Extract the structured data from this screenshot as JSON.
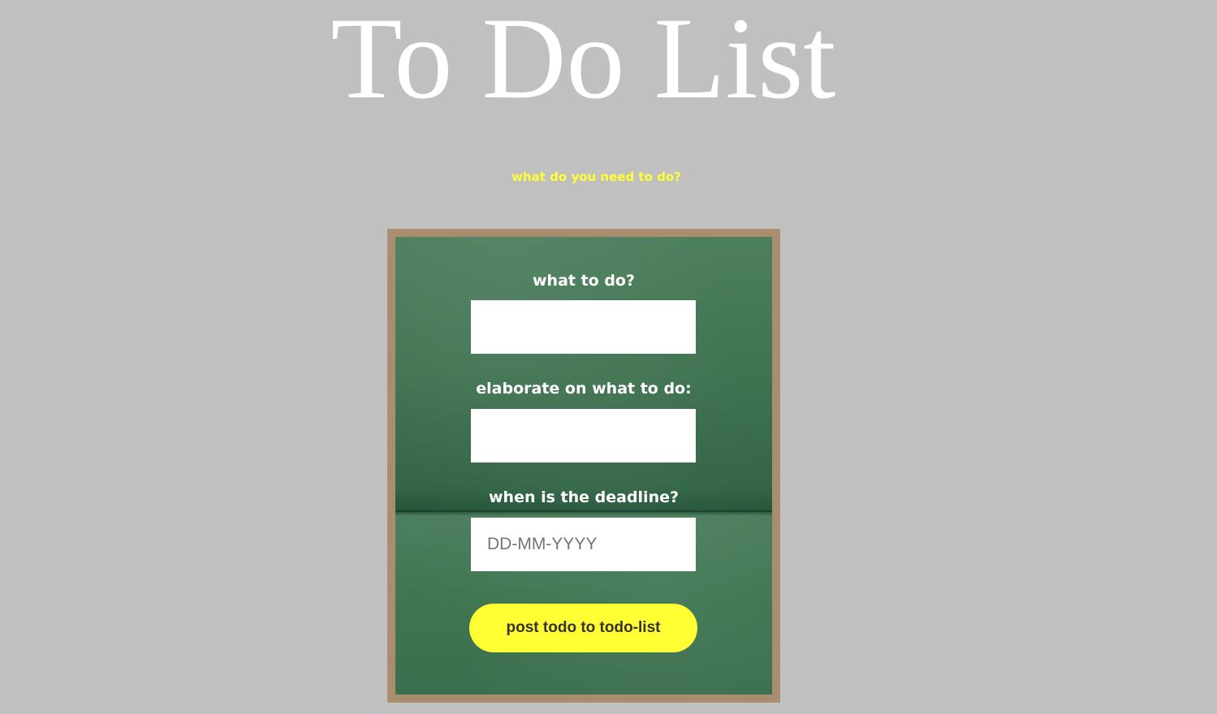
{
  "header": {
    "title": "To Do List",
    "subtitle": "what do you need to do?"
  },
  "form": {
    "what_label": "what to do?",
    "what_value": "",
    "what_placeholder": "",
    "elaborate_label": "elaborate on what to do:",
    "elaborate_value": "",
    "elaborate_placeholder": "",
    "deadline_label": "when is the deadline?",
    "deadline_value": "",
    "deadline_placeholder": "DD-MM-YYYY",
    "submit_label": "post todo to todo-list"
  },
  "colors": {
    "page_background": "#c0c0c0",
    "title_text": "#ffffff",
    "accent_yellow": "#ffff33",
    "board_green": "#3f7350",
    "frame_wood": "#a88e6e"
  }
}
